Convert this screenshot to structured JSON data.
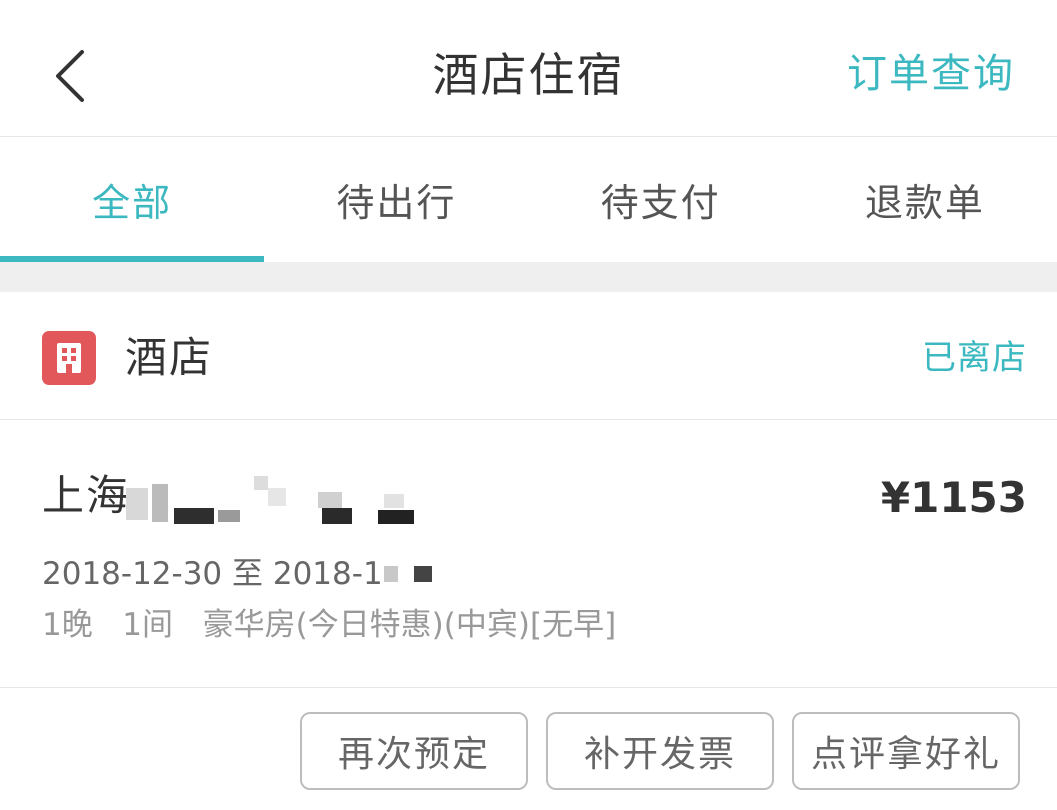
{
  "header": {
    "title": "酒店住宿",
    "order_query_label": "订单查询",
    "back_icon": "chevron-left-icon"
  },
  "tabs": [
    {
      "label": "全部",
      "active": true
    },
    {
      "label": "待出行",
      "active": false
    },
    {
      "label": "待支付",
      "active": false
    },
    {
      "label": "退款单",
      "active": false
    }
  ],
  "order": {
    "type_label": "酒店",
    "type_icon": "hotel-building-icon",
    "status": "已离店",
    "hotel_name": "上海",
    "price": "¥1153",
    "dates": "2018-12-30 至 2018-1",
    "nights": "1晚",
    "rooms": "1间",
    "room_type": "豪华房(今日特惠)(中宾)[无早]"
  },
  "actions": {
    "rebook_label": "再次预定",
    "invoice_label": "补开发票",
    "review_label": "点评拿好礼"
  },
  "colors": {
    "accent": "#3cb8c0",
    "hotel_icon_bg": "#e2585a",
    "divider": "#e6e6e6",
    "gap_bg": "#efefef"
  }
}
